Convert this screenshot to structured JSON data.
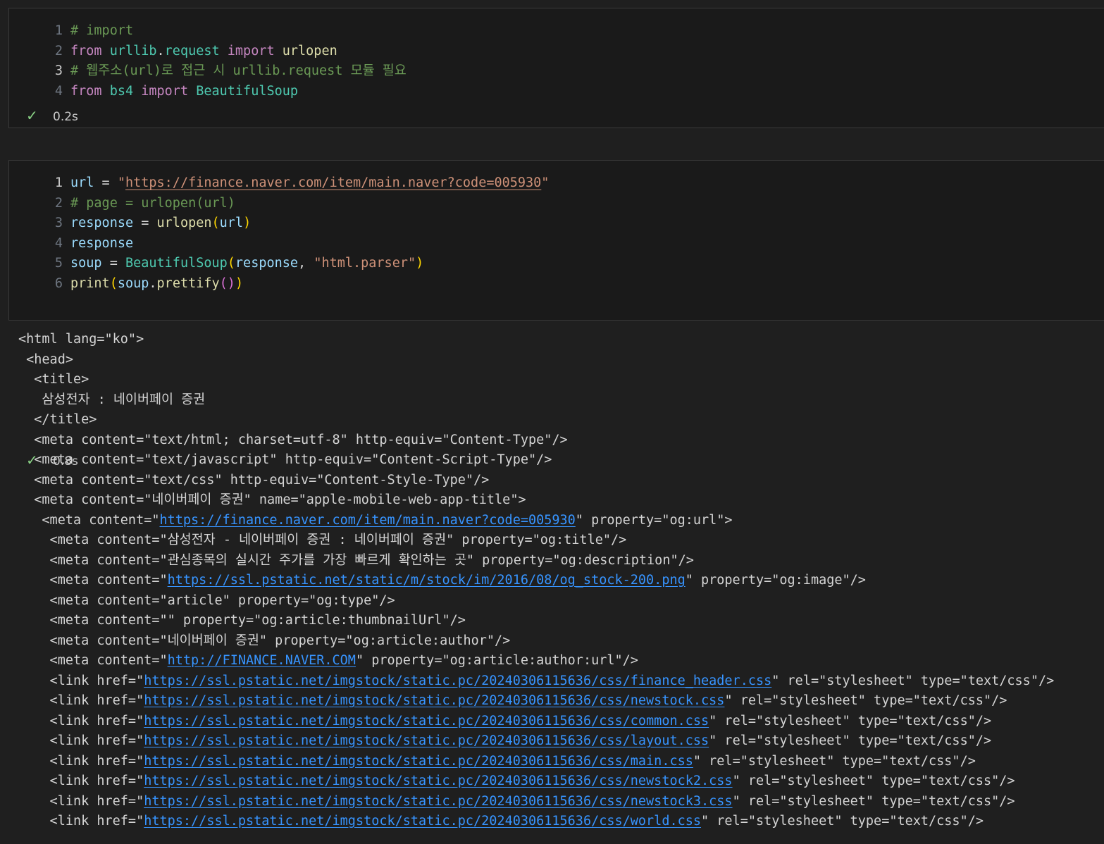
{
  "cell1": {
    "lines": [
      {
        "n": "1",
        "parts": [
          {
            "t": "# import",
            "c": "cmt"
          }
        ]
      },
      {
        "n": "2",
        "parts": [
          {
            "t": "from",
            "c": "kw"
          },
          {
            "t": " ",
            "c": "op"
          },
          {
            "t": "urllib",
            "c": "cls"
          },
          {
            "t": ".",
            "c": "op"
          },
          {
            "t": "request",
            "c": "cls"
          },
          {
            "t": " ",
            "c": "op"
          },
          {
            "t": "import",
            "c": "kw"
          },
          {
            "t": " ",
            "c": "op"
          },
          {
            "t": "urlopen",
            "c": "fn"
          }
        ]
      },
      {
        "n": "3",
        "active": true,
        "parts": [
          {
            "t": "# 웹주소(url)로 접근 시 urllib.request 모듈 필요",
            "c": "cmt"
          }
        ]
      },
      {
        "n": "4",
        "parts": [
          {
            "t": "from",
            "c": "kw"
          },
          {
            "t": " ",
            "c": "op"
          },
          {
            "t": "bs4",
            "c": "cls"
          },
          {
            "t": " ",
            "c": "op"
          },
          {
            "t": "import",
            "c": "kw"
          },
          {
            "t": " ",
            "c": "op"
          },
          {
            "t": "BeautifulSoup",
            "c": "cls"
          }
        ]
      }
    ],
    "status": {
      "time": "0.2s"
    }
  },
  "cell2": {
    "lines": [
      {
        "n": "1",
        "active": true,
        "parts": [
          {
            "t": "url",
            "c": "var"
          },
          {
            "t": " = ",
            "c": "op"
          },
          {
            "t": "\"",
            "c": "str"
          },
          {
            "t": "https://finance.naver.com/item/main.naver?code=005930",
            "c": "str ul"
          },
          {
            "t": "\"",
            "c": "str"
          }
        ]
      },
      {
        "n": "2",
        "parts": [
          {
            "t": "# page = urlopen(url)",
            "c": "cmt"
          }
        ]
      },
      {
        "n": "3",
        "parts": [
          {
            "t": "response",
            "c": "var"
          },
          {
            "t": " = ",
            "c": "op"
          },
          {
            "t": "urlopen",
            "c": "fn"
          },
          {
            "t": "(",
            "c": "br1"
          },
          {
            "t": "url",
            "c": "var"
          },
          {
            "t": ")",
            "c": "br1"
          }
        ]
      },
      {
        "n": "4",
        "parts": [
          {
            "t": "response",
            "c": "var"
          }
        ]
      },
      {
        "n": "5",
        "parts": [
          {
            "t": "soup",
            "c": "var"
          },
          {
            "t": " = ",
            "c": "op"
          },
          {
            "t": "BeautifulSoup",
            "c": "cls"
          },
          {
            "t": "(",
            "c": "br1"
          },
          {
            "t": "response",
            "c": "var"
          },
          {
            "t": ", ",
            "c": "op"
          },
          {
            "t": "\"html.parser\"",
            "c": "str"
          },
          {
            "t": ")",
            "c": "br1"
          }
        ]
      },
      {
        "n": "6",
        "parts": [
          {
            "t": "print",
            "c": "fn"
          },
          {
            "t": "(",
            "c": "br1"
          },
          {
            "t": "soup",
            "c": "var"
          },
          {
            "t": ".",
            "c": "op"
          },
          {
            "t": "prettify",
            "c": "fn"
          },
          {
            "t": "(",
            "c": "br2"
          },
          {
            "t": ")",
            "c": "br2"
          },
          {
            "t": ")",
            "c": "br1"
          }
        ]
      }
    ],
    "status": {
      "time": "0.8s"
    }
  },
  "output": [
    {
      "parts": [
        {
          "t": "<html lang=\"ko\">"
        }
      ]
    },
    {
      "parts": [
        {
          "t": " <head>"
        }
      ]
    },
    {
      "parts": [
        {
          "t": "  <title>"
        }
      ]
    },
    {
      "parts": [
        {
          "t": "   삼성전자 : 네이버페이 증권"
        }
      ]
    },
    {
      "parts": [
        {
          "t": "  </title>"
        }
      ]
    },
    {
      "parts": [
        {
          "t": "  <meta content=\"text/html; charset=utf-8\" http-equiv=\"Content-Type\"/>"
        }
      ]
    },
    {
      "parts": [
        {
          "t": "  <meta content=\"text/javascript\" http-equiv=\"Content-Script-Type\"/>"
        }
      ]
    },
    {
      "parts": [
        {
          "t": "  <meta content=\"text/css\" http-equiv=\"Content-Style-Type\"/>"
        }
      ]
    },
    {
      "parts": [
        {
          "t": "  <meta content=\"네이버페이 증권\" name=\"apple-mobile-web-app-title\">"
        }
      ]
    },
    {
      "parts": [
        {
          "t": "   <meta content=\""
        },
        {
          "t": "https://finance.naver.com/item/main.naver?code=005930",
          "link": true
        },
        {
          "t": "\" property=\"og:url\">"
        }
      ]
    },
    {
      "parts": [
        {
          "t": "    <meta content=\"삼성전자 - 네이버페이 증권 : 네이버페이 증권\" property=\"og:title\"/>"
        }
      ]
    },
    {
      "parts": [
        {
          "t": "    <meta content=\"관심종목의 실시간 주가를 가장 빠르게 확인하는 곳\" property=\"og:description\"/>"
        }
      ]
    },
    {
      "parts": [
        {
          "t": "    <meta content=\""
        },
        {
          "t": "https://ssl.pstatic.net/static/m/stock/im/2016/08/og_stock-200.png",
          "link": true
        },
        {
          "t": "\" property=\"og:image\"/>"
        }
      ]
    },
    {
      "parts": [
        {
          "t": "    <meta content=\"article\" property=\"og:type\"/>"
        }
      ]
    },
    {
      "parts": [
        {
          "t": "    <meta content=\"\" property=\"og:article:thumbnailUrl\"/>"
        }
      ]
    },
    {
      "parts": [
        {
          "t": "    <meta content=\"네이버페이 증권\" property=\"og:article:author\"/>"
        }
      ]
    },
    {
      "parts": [
        {
          "t": "    <meta content=\""
        },
        {
          "t": "http://FINANCE.NAVER.COM",
          "link": true
        },
        {
          "t": "\" property=\"og:article:author:url\"/>"
        }
      ]
    },
    {
      "parts": [
        {
          "t": "    <link href=\""
        },
        {
          "t": "https://ssl.pstatic.net/imgstock/static.pc/20240306115636/css/finance_header.css",
          "link": true
        },
        {
          "t": "\" rel=\"stylesheet\" type=\"text/css\"/>"
        }
      ]
    },
    {
      "parts": [
        {
          "t": "    <link href=\""
        },
        {
          "t": "https://ssl.pstatic.net/imgstock/static.pc/20240306115636/css/newstock.css",
          "link": true
        },
        {
          "t": "\" rel=\"stylesheet\" type=\"text/css\"/>"
        }
      ]
    },
    {
      "parts": [
        {
          "t": "    <link href=\""
        },
        {
          "t": "https://ssl.pstatic.net/imgstock/static.pc/20240306115636/css/common.css",
          "link": true
        },
        {
          "t": "\" rel=\"stylesheet\" type=\"text/css\"/>"
        }
      ]
    },
    {
      "parts": [
        {
          "t": "    <link href=\""
        },
        {
          "t": "https://ssl.pstatic.net/imgstock/static.pc/20240306115636/css/layout.css",
          "link": true
        },
        {
          "t": "\" rel=\"stylesheet\" type=\"text/css\"/>"
        }
      ]
    },
    {
      "parts": [
        {
          "t": "    <link href=\""
        },
        {
          "t": "https://ssl.pstatic.net/imgstock/static.pc/20240306115636/css/main.css",
          "link": true
        },
        {
          "t": "\" rel=\"stylesheet\" type=\"text/css\"/>"
        }
      ]
    },
    {
      "parts": [
        {
          "t": "    <link href=\""
        },
        {
          "t": "https://ssl.pstatic.net/imgstock/static.pc/20240306115636/css/newstock2.css",
          "link": true
        },
        {
          "t": "\" rel=\"stylesheet\" type=\"text/css\"/>"
        }
      ]
    },
    {
      "parts": [
        {
          "t": "    <link href=\""
        },
        {
          "t": "https://ssl.pstatic.net/imgstock/static.pc/20240306115636/css/newstock3.css",
          "link": true
        },
        {
          "t": "\" rel=\"stylesheet\" type=\"text/css\"/>"
        }
      ]
    },
    {
      "parts": [
        {
          "t": "    <link href=\""
        },
        {
          "t": "https://ssl.pstatic.net/imgstock/static.pc/20240306115636/css/world.css",
          "link": true
        },
        {
          "t": "\" rel=\"stylesheet\" type=\"text/css\"/>"
        }
      ]
    }
  ]
}
